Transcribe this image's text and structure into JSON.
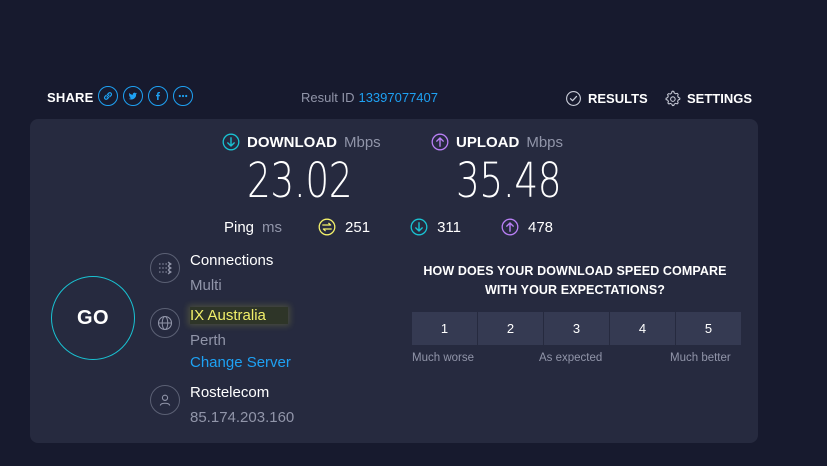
{
  "topbar": {
    "share_label": "SHARE",
    "share_icons": [
      "link-icon",
      "twitter-icon",
      "facebook-icon",
      "more-icon"
    ],
    "result_label": "Result ID",
    "result_id": "13397077407",
    "results_label": "RESULTS",
    "settings_label": "SETTINGS"
  },
  "download": {
    "label": "DOWNLOAD",
    "unit": "Mbps",
    "value": "23.02"
  },
  "upload": {
    "label": "UPLOAD",
    "unit": "Mbps",
    "value": "35.48"
  },
  "ping": {
    "label": "Ping",
    "unit": "ms",
    "idle": "251",
    "download": "311",
    "upload": "478"
  },
  "go_label": "GO",
  "connections": {
    "title": "Connections",
    "value": "Multi"
  },
  "server": {
    "name": "IX Australia",
    "location": "Perth",
    "change_label": "Change Server"
  },
  "provider": {
    "name": "Rostelecom",
    "ip": "85.174.203.160"
  },
  "survey": {
    "question_line1": "HOW DOES YOUR DOWNLOAD SPEED COMPARE",
    "question_line2": "WITH YOUR EXPECTATIONS?",
    "options": [
      "1",
      "2",
      "3",
      "4",
      "5"
    ],
    "label_low": "Much worse",
    "label_mid": "As expected",
    "label_high": "Much better"
  },
  "colors": {
    "background": "#171a2e",
    "panel": "#262a3f",
    "accent_blue": "#1ea1f3",
    "download_cyan": "#19c2d2",
    "upload_purple": "#b87ff5",
    "ping_yellow": "#f2f06a"
  }
}
